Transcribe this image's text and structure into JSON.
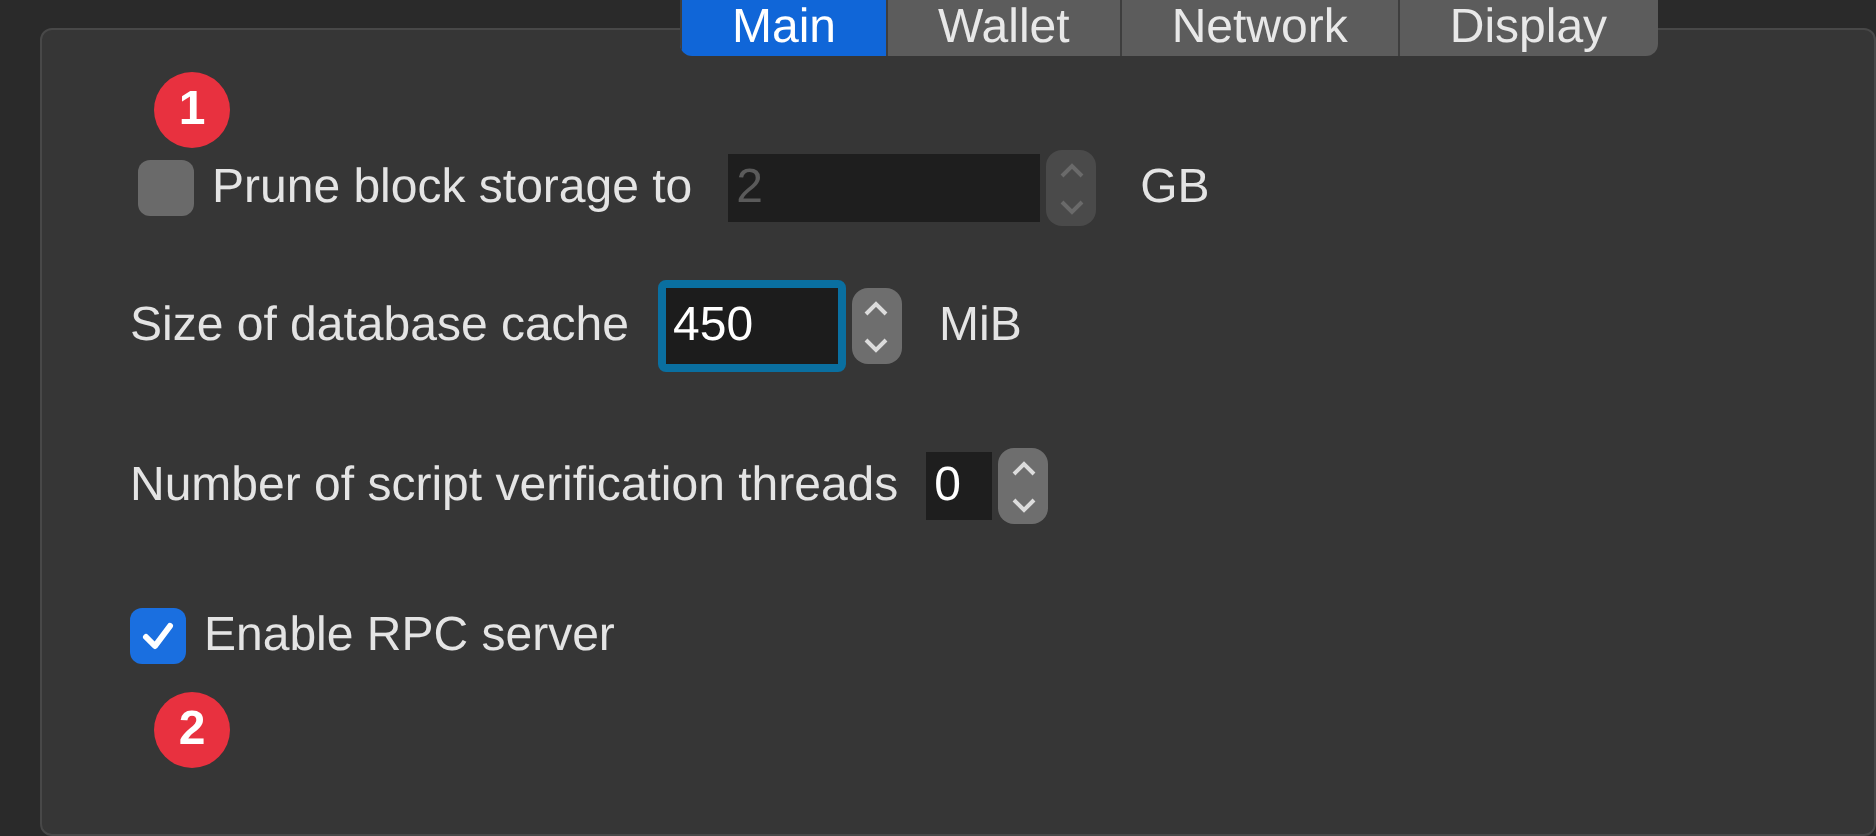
{
  "tabs": [
    {
      "label": "Main",
      "selected": true
    },
    {
      "label": "Wallet",
      "selected": false
    },
    {
      "label": "Network",
      "selected": false
    },
    {
      "label": "Display",
      "selected": false
    }
  ],
  "options": [
    {
      "kind": "checkbox-spin",
      "label": "Prune block storage to",
      "checked": false,
      "value": "2",
      "disabled": true,
      "unit": "GB"
    },
    {
      "kind": "spin",
      "label": "Size of database cache",
      "value": "450",
      "focused": true,
      "disabled": false,
      "unit": "MiB"
    },
    {
      "kind": "spin",
      "label": "Number of script verification threads",
      "value": "0",
      "focused": false,
      "disabled": false
    },
    {
      "kind": "checkbox",
      "label": "Enable RPC server",
      "checked": true
    }
  ],
  "annotations": [
    {
      "label": "1"
    },
    {
      "label": "2"
    }
  ]
}
